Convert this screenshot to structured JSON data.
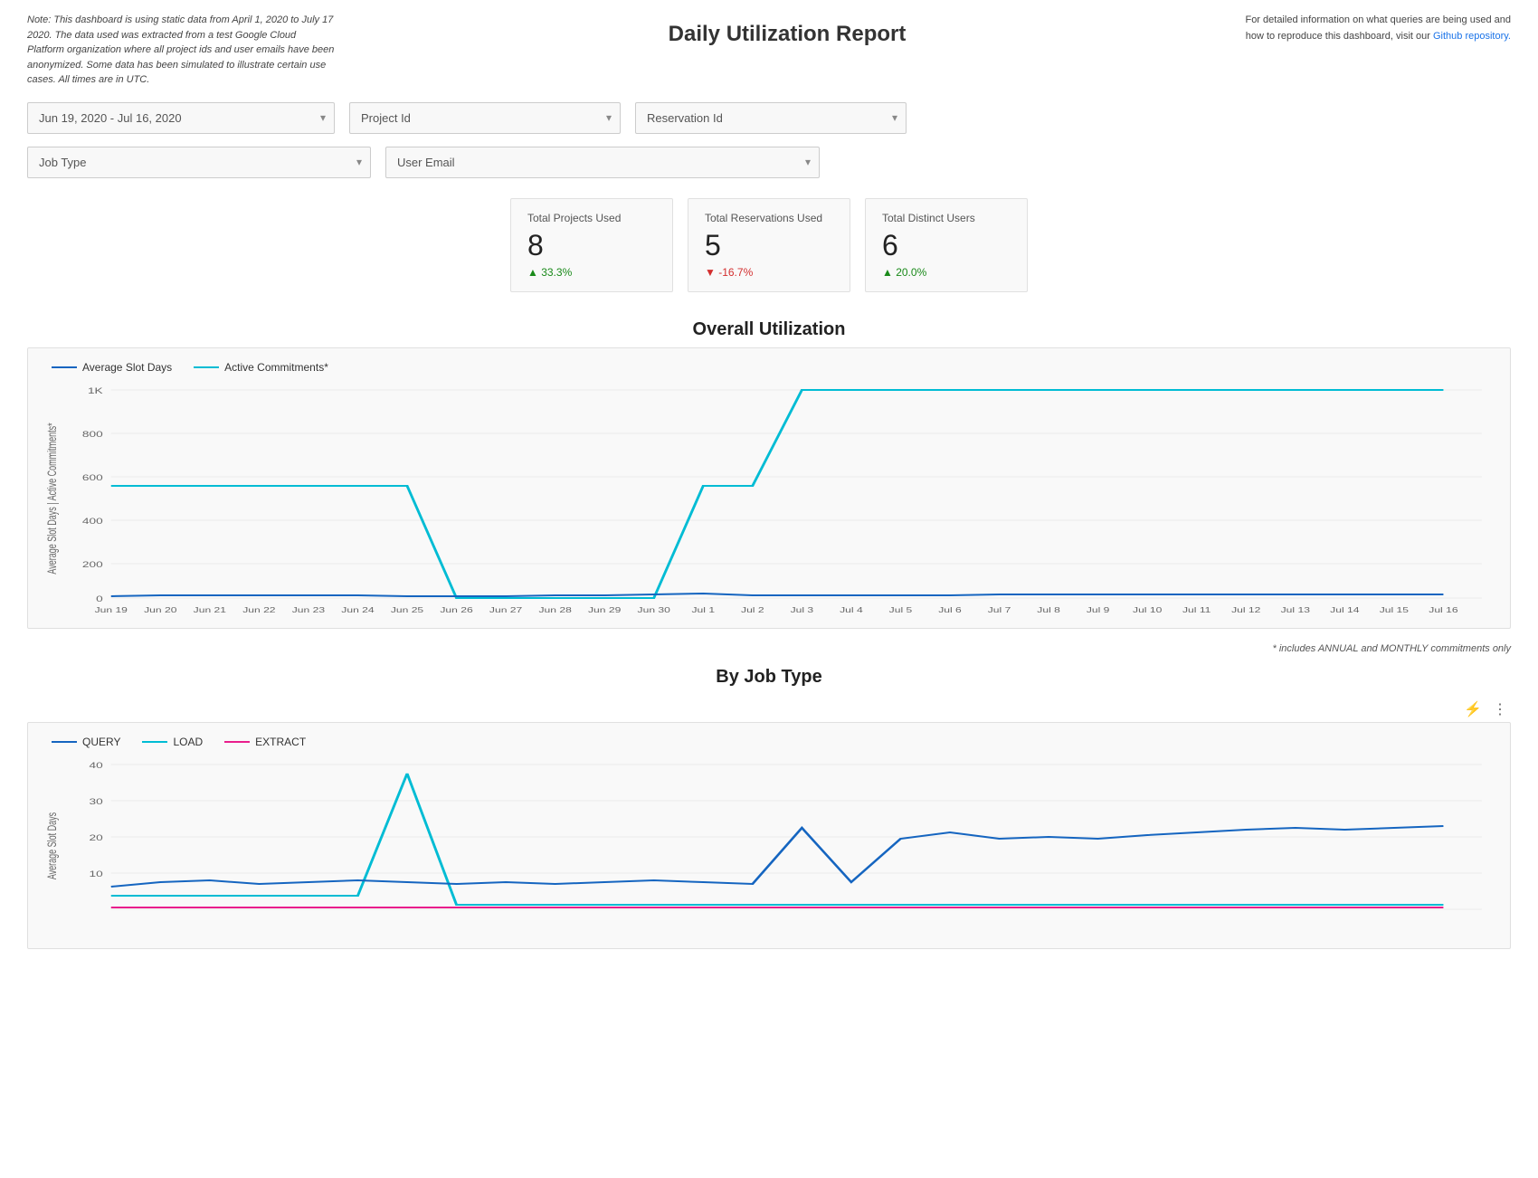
{
  "header": {
    "note": "Note: This dashboard is using static data from April 1, 2020 to July 17 2020. The data used was extracted from a test Google Cloud Platform organization where all project ids and user emails have been anonymized. Some data has been simulated to illustrate certain use cases. All times are in UTC.",
    "title": "Daily Utilization Report",
    "right_note": "For detailed information on what queries are being used and how to reproduce this dashboard, visit our ",
    "right_link": "Github repository.",
    "right_link_href": "#"
  },
  "filters": {
    "date_range": {
      "label": "Jun 19, 2020 - Jul 16, 2020",
      "placeholder": "Jun 19, 2020 - Jul 16, 2020"
    },
    "project_id": {
      "label": "Project Id",
      "placeholder": "Project Id"
    },
    "reservation_id": {
      "label": "Reservation Id",
      "placeholder": "Reservation Id"
    },
    "job_type": {
      "label": "Job Type",
      "placeholder": "Job Type"
    },
    "user_email": {
      "label": "User Email",
      "placeholder": "User Email"
    }
  },
  "metrics": [
    {
      "label": "Total Projects Used",
      "value": "8",
      "change": "▲ 33.3%",
      "change_type": "positive"
    },
    {
      "label": "Total Reservations Used",
      "value": "5",
      "change": "▼ -16.7%",
      "change_type": "negative"
    },
    {
      "label": "Total Distinct Users",
      "value": "6",
      "change": "▲ 20.0%",
      "change_type": "positive"
    }
  ],
  "overall_chart": {
    "title": "Overall Utilization",
    "legend": [
      {
        "label": "Average Slot Days",
        "color": "#1565c0"
      },
      {
        "label": "Active Commitments*",
        "color": "#00bcd4"
      }
    ],
    "y_axis_label": "Average Slot Days | Active Commitments*",
    "y_max": 1000,
    "x_labels": [
      "Jun 19",
      "Jun 20",
      "Jun 21",
      "Jun 22",
      "Jun 23",
      "Jun 24",
      "Jun 25",
      "Jun 26",
      "Jun 27",
      "Jun 28",
      "Jun 29",
      "Jun 30",
      "Jul 1",
      "Jul 2",
      "Jul 3",
      "Jul 4",
      "Jul 5",
      "Jul 6",
      "Jul 7",
      "Jul 8",
      "Jul 9",
      "Jul 10",
      "Jul 11",
      "Jul 12",
      "Jul 13",
      "Jul 14",
      "Jul 15",
      "Jul 16"
    ],
    "note": "* includes ANNUAL and MONTHLY commitments only"
  },
  "by_job_type_chart": {
    "title": "By Job Type",
    "legend": [
      {
        "label": "QUERY",
        "color": "#1565c0"
      },
      {
        "label": "LOAD",
        "color": "#00bcd4"
      },
      {
        "label": "EXTRACT",
        "color": "#e91e8c"
      }
    ],
    "y_axis_label": "Average Slot Days",
    "y_max": 40
  }
}
